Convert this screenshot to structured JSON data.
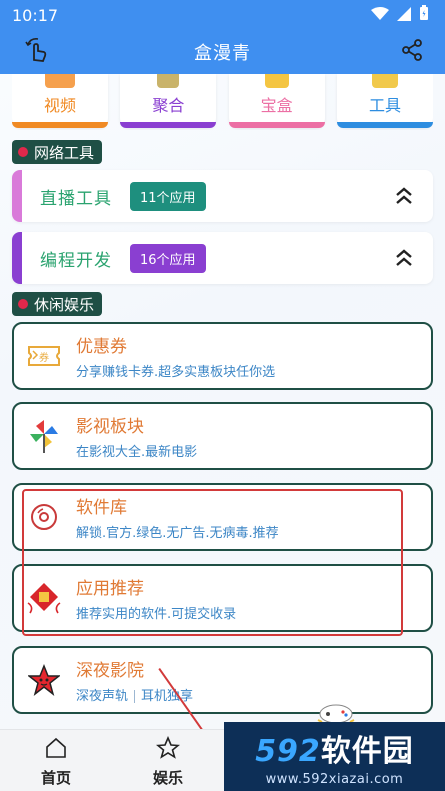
{
  "status_bar": {
    "time": "10:17"
  },
  "header": {
    "title": "盒漫青"
  },
  "top_categories": [
    {
      "label": "视频",
      "color": "#f08a24"
    },
    {
      "label": "聚合",
      "color": "#8a3fd1"
    },
    {
      "label": "宝盒",
      "color": "#ec6fa4"
    },
    {
      "label": "工具",
      "color": "#2d8de0"
    }
  ],
  "sections": {
    "network_tools": "网络工具",
    "leisure": "休闲娱乐"
  },
  "groups": [
    {
      "title": "直播工具",
      "badge": "11个应用",
      "accent": "#d97ad9",
      "badge_color": "#1e8f7e"
    },
    {
      "title": "编程开发",
      "badge": "16个应用",
      "accent": "#8a3fd1",
      "badge_color": "#8a3fd1"
    }
  ],
  "features": [
    {
      "title": "优惠券",
      "desc": "分享赚钱卡券.超多实惠板块任你选",
      "icon": "coupon-icon"
    },
    {
      "title": "影视板块",
      "desc": "在影视大全.最新电影",
      "icon": "pinwheel-icon"
    },
    {
      "title": "软件库",
      "desc": "解锁.官方.绿色.无广告.无病毒.推荐",
      "icon": "disc-icon"
    },
    {
      "title": "应用推荐",
      "desc": "推荐实用的软件.可提交收录",
      "icon": "lucky-diamond-icon"
    },
    {
      "title": "深夜影院",
      "desc_a": "深夜声轨",
      "desc_b": "耳机独享",
      "icon": "star-face-icon"
    }
  ],
  "bottom_nav": [
    {
      "label": "首页",
      "icon": "home-icon"
    },
    {
      "label": "娱乐",
      "icon": "star-outline-icon"
    }
  ],
  "watermark": {
    "brand_num": "592",
    "brand_text": "软件园",
    "url": "www.592xiazai.com"
  }
}
